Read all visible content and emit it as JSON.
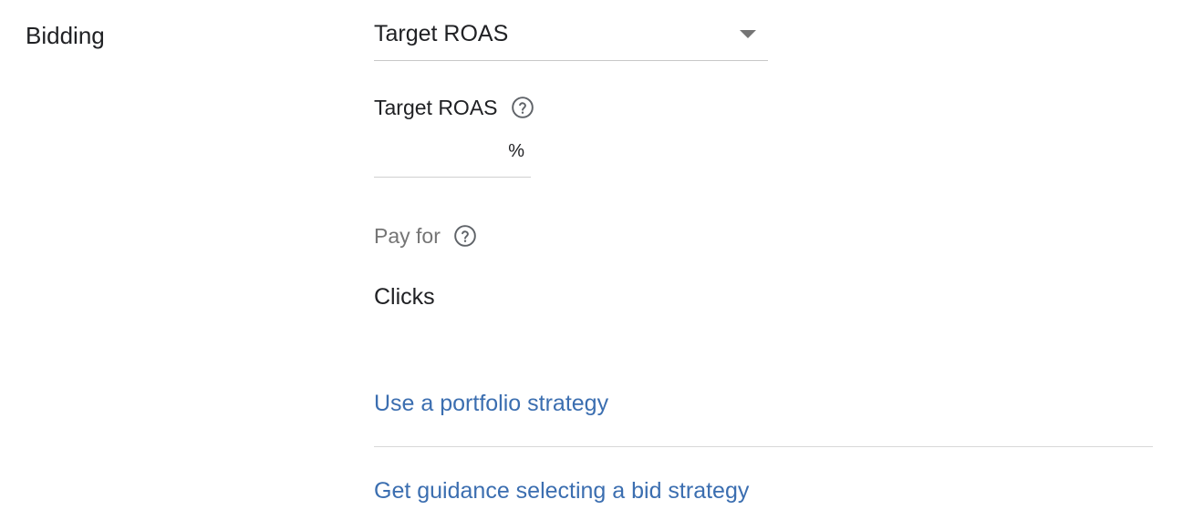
{
  "section": {
    "label": "Bidding"
  },
  "bid_strategy": {
    "selected": "Target ROAS",
    "caret_icon": "arrow-drop-down-icon"
  },
  "target_roas": {
    "label": "Target ROAS",
    "help_icon": "help-circle-icon",
    "value": "",
    "suffix": "%"
  },
  "pay_for": {
    "label": "Pay for",
    "help_icon": "help-circle-icon",
    "value": "Clicks"
  },
  "links": {
    "portfolio": "Use a portfolio strategy",
    "guidance": "Get guidance selecting a bid strategy"
  },
  "colors": {
    "link": "#3b6eb0",
    "text": "#202124",
    "muted": "#757575",
    "divider": "#d8d8d8"
  }
}
